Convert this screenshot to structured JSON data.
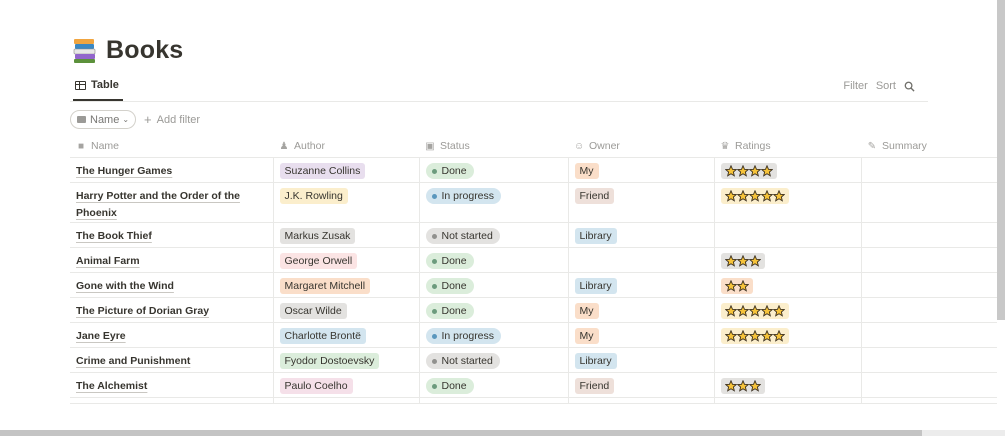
{
  "page": {
    "title": "Books",
    "icon": "books-stack-icon"
  },
  "view": {
    "tab_label": "Table",
    "tab_icon": "table-icon"
  },
  "actions": {
    "filter_label": "Filter",
    "sort_label": "Sort",
    "search_icon": "search-icon"
  },
  "filter_bar": {
    "chip_label": "Name",
    "add_filter_label": "Add filter"
  },
  "columns": [
    {
      "label": "Name",
      "icon": "title-icon"
    },
    {
      "label": "Author",
      "icon": "person-icon"
    },
    {
      "label": "Status",
      "icon": "status-icon"
    },
    {
      "label": "Owner",
      "icon": "owner-icon"
    },
    {
      "label": "Ratings",
      "icon": "crown-icon"
    },
    {
      "label": "Summary",
      "icon": "pencil-icon"
    }
  ],
  "colors": {
    "purple": "#e8deee",
    "yellow": "#fbeecc",
    "gray": "#e3e2e0",
    "red": "#fbe4e4",
    "orange": "#fadec9",
    "green": "#dbeddb",
    "pink": "#f5e0e9",
    "blue": "#d3e5ef",
    "brown": "#eee0da",
    "done_dot": "#6c9b7d",
    "progress_dot": "#5b97bd",
    "notstarted_dot": "#91918e"
  },
  "rows": [
    {
      "name": "The Hunger Games",
      "author": "Suzanne Collins",
      "author_color": "purple",
      "status": "Done",
      "owner": "My",
      "owner_color": "orange",
      "rating": 4
    },
    {
      "name": "Harry Potter and the Order of the Phoenix",
      "author": "J.K. Rowling",
      "author_color": "yellow",
      "status": "In progress",
      "owner": "Friend",
      "owner_color": "brown",
      "rating": 5
    },
    {
      "name": "The Book Thief",
      "author": "Markus Zusak",
      "author_color": "gray",
      "status": "Not started",
      "owner": "Library",
      "owner_color": "blue",
      "rating": 0
    },
    {
      "name": "Animal Farm",
      "author": "George Orwell",
      "author_color": "red",
      "status": "Done",
      "owner": "",
      "owner_color": "",
      "rating": 3
    },
    {
      "name": "Gone with the Wind",
      "author": "Margaret Mitchell",
      "author_color": "orange",
      "status": "Done",
      "owner": "Library",
      "owner_color": "blue",
      "rating": 2
    },
    {
      "name": "The Picture of Dorian Gray",
      "author": "Oscar Wilde",
      "author_color": "gray",
      "status": "Done",
      "owner": "My",
      "owner_color": "orange",
      "rating": 5
    },
    {
      "name": "Jane Eyre",
      "author": "Charlotte Brontë",
      "author_color": "blue",
      "status": "In progress",
      "owner": "My",
      "owner_color": "orange",
      "rating": 5
    },
    {
      "name": "Crime and Punishment",
      "author": "Fyodor Dostoevsky",
      "author_color": "green",
      "status": "Not started",
      "owner": "Library",
      "owner_color": "blue",
      "rating": 0
    },
    {
      "name": "The Alchemist",
      "author": "Paulo Coelho",
      "author_color": "pink",
      "status": "Done",
      "owner": "Friend",
      "owner_color": "brown",
      "rating": 3
    }
  ]
}
